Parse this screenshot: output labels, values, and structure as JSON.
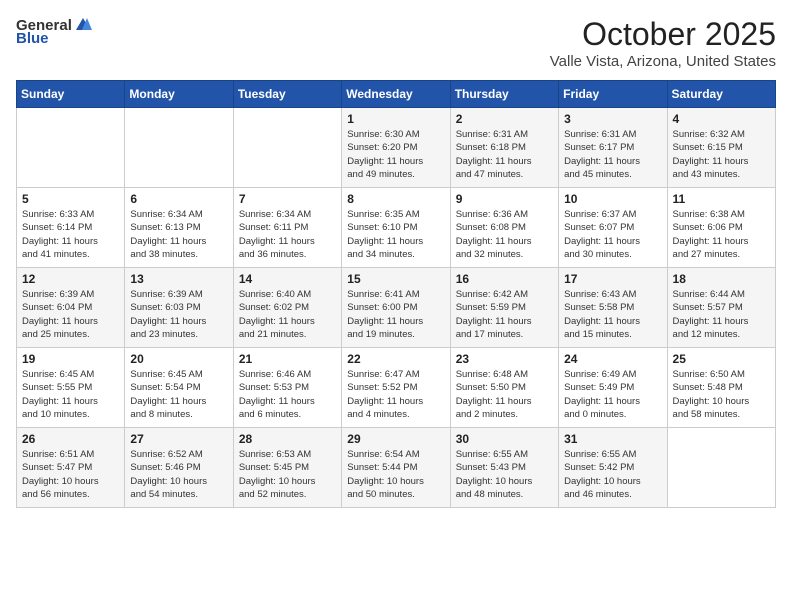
{
  "header": {
    "logo_general": "General",
    "logo_blue": "Blue",
    "month": "October 2025",
    "location": "Valle Vista, Arizona, United States"
  },
  "days_of_week": [
    "Sunday",
    "Monday",
    "Tuesday",
    "Wednesday",
    "Thursday",
    "Friday",
    "Saturday"
  ],
  "weeks": [
    [
      {
        "day": "",
        "info": ""
      },
      {
        "day": "",
        "info": ""
      },
      {
        "day": "",
        "info": ""
      },
      {
        "day": "1",
        "info": "Sunrise: 6:30 AM\nSunset: 6:20 PM\nDaylight: 11 hours\nand 49 minutes."
      },
      {
        "day": "2",
        "info": "Sunrise: 6:31 AM\nSunset: 6:18 PM\nDaylight: 11 hours\nand 47 minutes."
      },
      {
        "day": "3",
        "info": "Sunrise: 6:31 AM\nSunset: 6:17 PM\nDaylight: 11 hours\nand 45 minutes."
      },
      {
        "day": "4",
        "info": "Sunrise: 6:32 AM\nSunset: 6:15 PM\nDaylight: 11 hours\nand 43 minutes."
      }
    ],
    [
      {
        "day": "5",
        "info": "Sunrise: 6:33 AM\nSunset: 6:14 PM\nDaylight: 11 hours\nand 41 minutes."
      },
      {
        "day": "6",
        "info": "Sunrise: 6:34 AM\nSunset: 6:13 PM\nDaylight: 11 hours\nand 38 minutes."
      },
      {
        "day": "7",
        "info": "Sunrise: 6:34 AM\nSunset: 6:11 PM\nDaylight: 11 hours\nand 36 minutes."
      },
      {
        "day": "8",
        "info": "Sunrise: 6:35 AM\nSunset: 6:10 PM\nDaylight: 11 hours\nand 34 minutes."
      },
      {
        "day": "9",
        "info": "Sunrise: 6:36 AM\nSunset: 6:08 PM\nDaylight: 11 hours\nand 32 minutes."
      },
      {
        "day": "10",
        "info": "Sunrise: 6:37 AM\nSunset: 6:07 PM\nDaylight: 11 hours\nand 30 minutes."
      },
      {
        "day": "11",
        "info": "Sunrise: 6:38 AM\nSunset: 6:06 PM\nDaylight: 11 hours\nand 27 minutes."
      }
    ],
    [
      {
        "day": "12",
        "info": "Sunrise: 6:39 AM\nSunset: 6:04 PM\nDaylight: 11 hours\nand 25 minutes."
      },
      {
        "day": "13",
        "info": "Sunrise: 6:39 AM\nSunset: 6:03 PM\nDaylight: 11 hours\nand 23 minutes."
      },
      {
        "day": "14",
        "info": "Sunrise: 6:40 AM\nSunset: 6:02 PM\nDaylight: 11 hours\nand 21 minutes."
      },
      {
        "day": "15",
        "info": "Sunrise: 6:41 AM\nSunset: 6:00 PM\nDaylight: 11 hours\nand 19 minutes."
      },
      {
        "day": "16",
        "info": "Sunrise: 6:42 AM\nSunset: 5:59 PM\nDaylight: 11 hours\nand 17 minutes."
      },
      {
        "day": "17",
        "info": "Sunrise: 6:43 AM\nSunset: 5:58 PM\nDaylight: 11 hours\nand 15 minutes."
      },
      {
        "day": "18",
        "info": "Sunrise: 6:44 AM\nSunset: 5:57 PM\nDaylight: 11 hours\nand 12 minutes."
      }
    ],
    [
      {
        "day": "19",
        "info": "Sunrise: 6:45 AM\nSunset: 5:55 PM\nDaylight: 11 hours\nand 10 minutes."
      },
      {
        "day": "20",
        "info": "Sunrise: 6:45 AM\nSunset: 5:54 PM\nDaylight: 11 hours\nand 8 minutes."
      },
      {
        "day": "21",
        "info": "Sunrise: 6:46 AM\nSunset: 5:53 PM\nDaylight: 11 hours\nand 6 minutes."
      },
      {
        "day": "22",
        "info": "Sunrise: 6:47 AM\nSunset: 5:52 PM\nDaylight: 11 hours\nand 4 minutes."
      },
      {
        "day": "23",
        "info": "Sunrise: 6:48 AM\nSunset: 5:50 PM\nDaylight: 11 hours\nand 2 minutes."
      },
      {
        "day": "24",
        "info": "Sunrise: 6:49 AM\nSunset: 5:49 PM\nDaylight: 11 hours\nand 0 minutes."
      },
      {
        "day": "25",
        "info": "Sunrise: 6:50 AM\nSunset: 5:48 PM\nDaylight: 10 hours\nand 58 minutes."
      }
    ],
    [
      {
        "day": "26",
        "info": "Sunrise: 6:51 AM\nSunset: 5:47 PM\nDaylight: 10 hours\nand 56 minutes."
      },
      {
        "day": "27",
        "info": "Sunrise: 6:52 AM\nSunset: 5:46 PM\nDaylight: 10 hours\nand 54 minutes."
      },
      {
        "day": "28",
        "info": "Sunrise: 6:53 AM\nSunset: 5:45 PM\nDaylight: 10 hours\nand 52 minutes."
      },
      {
        "day": "29",
        "info": "Sunrise: 6:54 AM\nSunset: 5:44 PM\nDaylight: 10 hours\nand 50 minutes."
      },
      {
        "day": "30",
        "info": "Sunrise: 6:55 AM\nSunset: 5:43 PM\nDaylight: 10 hours\nand 48 minutes."
      },
      {
        "day": "31",
        "info": "Sunrise: 6:55 AM\nSunset: 5:42 PM\nDaylight: 10 hours\nand 46 minutes."
      },
      {
        "day": "",
        "info": ""
      }
    ]
  ]
}
